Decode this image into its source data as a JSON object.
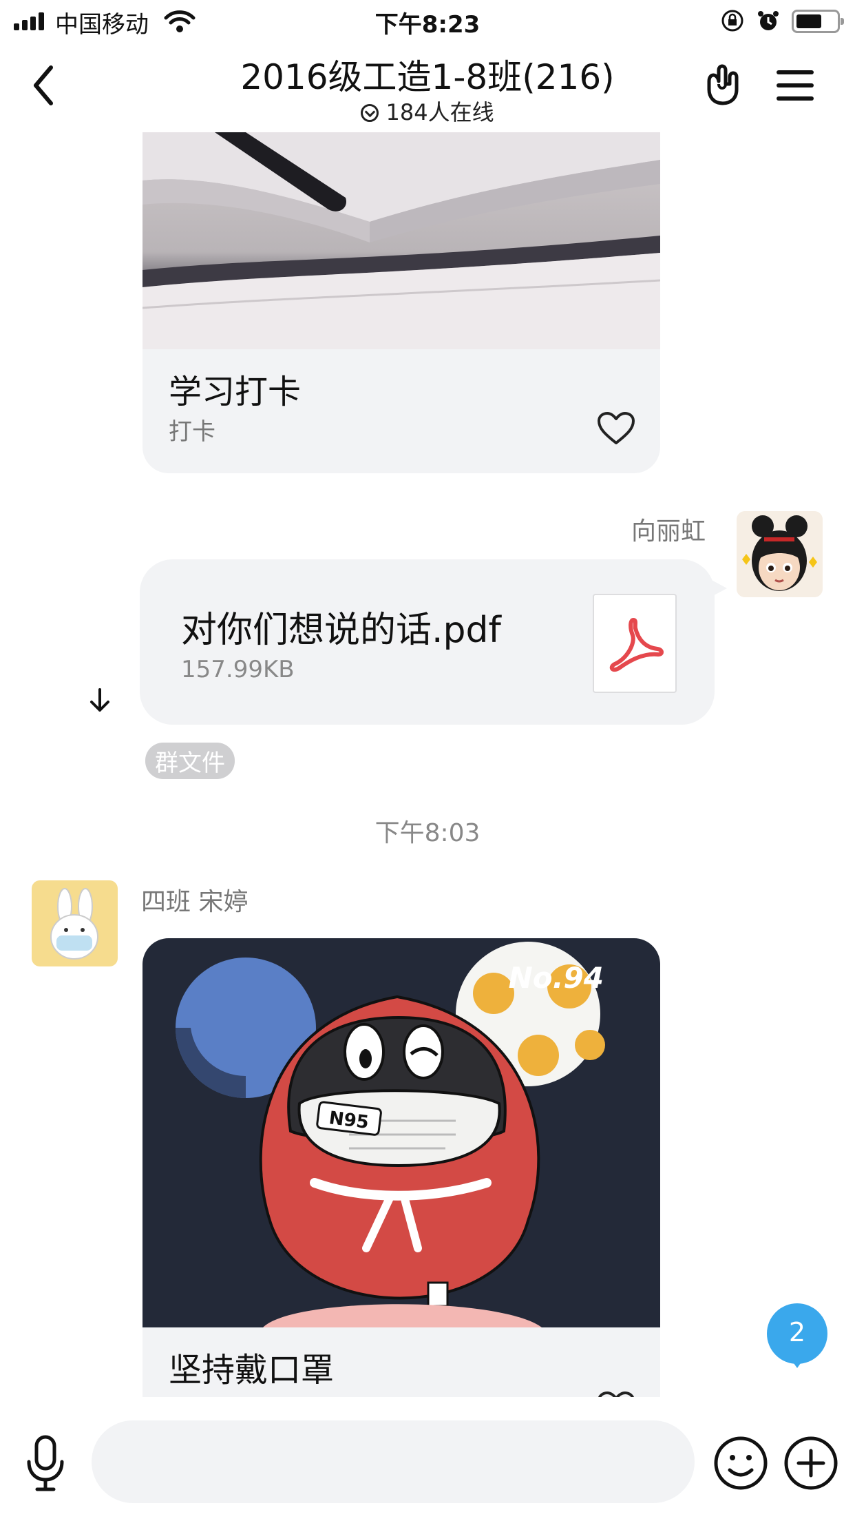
{
  "status_bar": {
    "carrier": "中国移动",
    "time": "下午8:23"
  },
  "header": {
    "title": "2016级工造1-8班(216)",
    "online": "184人在线"
  },
  "messages": {
    "checkin_card": {
      "title": "学习打卡",
      "subtitle": "打卡"
    },
    "file_msg": {
      "sender": "向丽虹",
      "file_name": "对你们想说的话.pdf",
      "file_size": "157.99KB",
      "tag": "群文件"
    },
    "time_separator": "下午8:03",
    "mask_msg": {
      "sender": "四班 宋婷",
      "badge_text": "No.94",
      "mask_text": "N95",
      "card_title": "坚持戴口罩"
    }
  },
  "unread_badge": "2",
  "colors": {
    "accent": "#1f8fe0",
    "card_bg": "#f2f3f5",
    "badge_blue": "#3aa8ec",
    "pdf_red": "#e5484d"
  }
}
